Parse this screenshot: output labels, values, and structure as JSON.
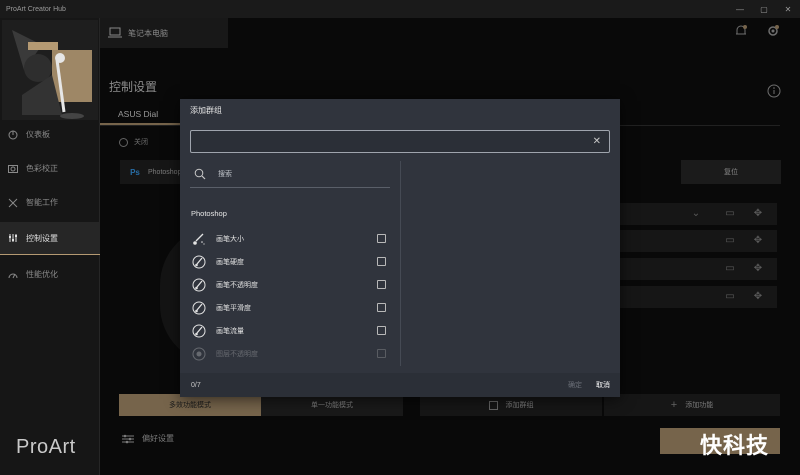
{
  "app": {
    "title": "ProArt Creator Hub",
    "logo_text": "ProArt"
  },
  "device": {
    "label": "笔记本电脑"
  },
  "sidebar": {
    "items": [
      {
        "label": "仪表板",
        "icon": "dashboard-icon"
      },
      {
        "label": "色彩校正",
        "icon": "color-icon"
      },
      {
        "label": "智能工作",
        "icon": "tools-icon"
      },
      {
        "label": "控制设置",
        "icon": "sliders-icon",
        "active": true
      },
      {
        "label": "性能优化",
        "icon": "performance-icon"
      }
    ]
  },
  "main": {
    "title": "控制设置",
    "tab": "ASUS Dial",
    "radio_label": "关闭",
    "app_select": "Photoshop",
    "reset_label": "复位",
    "modes": {
      "multi": "多效功能模式",
      "single": "单一功能模式"
    },
    "add_group": "添加群组",
    "add_function": "添加功能",
    "preferences": "偏好设置"
  },
  "dialog": {
    "title": "添加群组",
    "search_value": "",
    "search_label": "搜索",
    "group_name": "Photoshop",
    "items": [
      {
        "label": "画笔大小",
        "checked": false
      },
      {
        "label": "画笔硬度",
        "checked": false
      },
      {
        "label": "画笔不透明度",
        "checked": false
      },
      {
        "label": "画笔平滑度",
        "checked": false
      },
      {
        "label": "画笔流量",
        "checked": false
      },
      {
        "label": "图层不透明度",
        "checked": false
      }
    ],
    "count": "0/7",
    "confirm": "确定",
    "cancel": "取消"
  },
  "watermark": "快科技",
  "colors": {
    "accent": "#b59a73",
    "dialog_bg": "#30343d",
    "app_bg": "#0e0e0e",
    "sidebar_bg": "#161616"
  }
}
